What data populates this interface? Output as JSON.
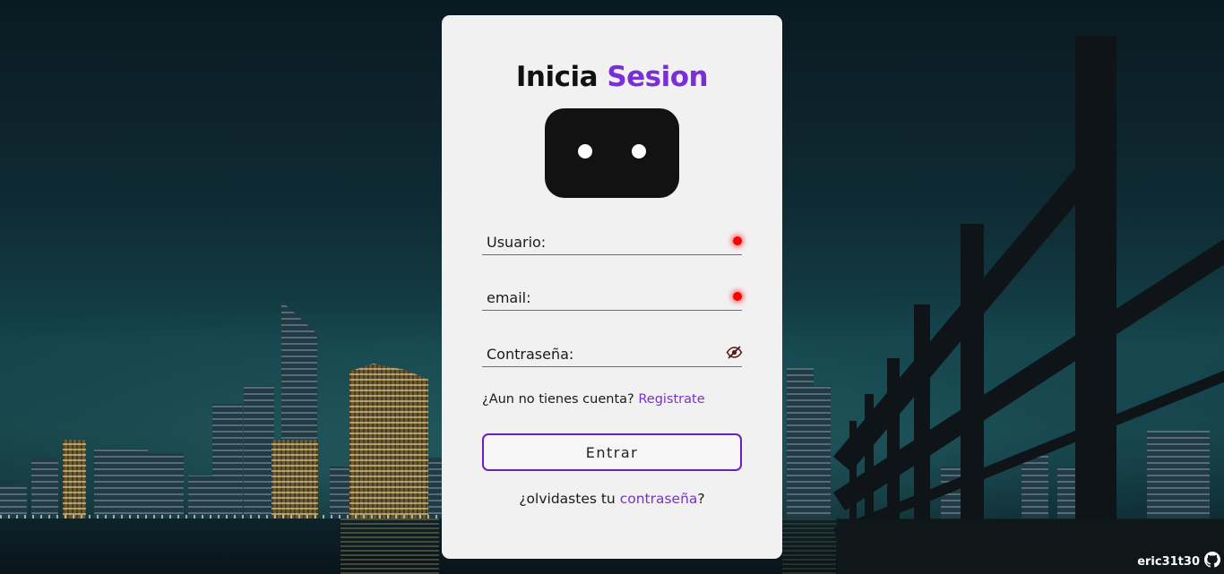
{
  "login": {
    "title_main": "Inicia",
    "title_accent": "Sesion",
    "fields": {
      "username_placeholder": "Usuario:",
      "email_placeholder": "email:",
      "password_placeholder": "Contraseña:"
    },
    "register_prompt": "¿Aun no tienes cuenta?",
    "register_link": "Registrate",
    "submit_label": "Entrar",
    "forgot_prefix": "¿olvidastes tu",
    "forgot_link": "contraseña",
    "forgot_suffix": "?"
  },
  "footer": {
    "credit": "eric31t30",
    "icon": "github-icon"
  },
  "colors": {
    "accent": "#7a2fd6",
    "button_border": "#6a1fc2",
    "invalid_indicator": "#ff0000",
    "card_bg": "#f2f1f2"
  },
  "icons": {
    "mascot": "mascot-face-icon",
    "password_toggle": "eye-slash-icon",
    "validation": "status-dot-icon"
  }
}
